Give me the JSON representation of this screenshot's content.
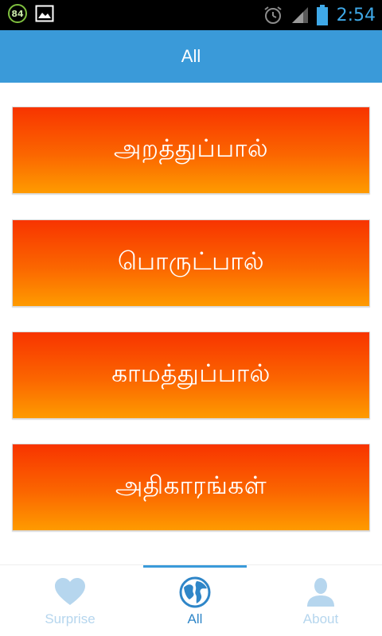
{
  "status_bar": {
    "notification_badge": "84",
    "clock": "2:54",
    "icons": [
      "notification-counter-icon",
      "gallery-icon",
      "alarm-icon",
      "signal-icon",
      "battery-icon"
    ]
  },
  "app_bar": {
    "title": "All"
  },
  "menu": {
    "items": [
      {
        "label": "அறத்துப்பால்"
      },
      {
        "label": "பொருட்பால்"
      },
      {
        "label": "காமத்துப்பால்"
      },
      {
        "label": "அதிகாரங்கள்"
      }
    ]
  },
  "bottom_nav": {
    "items": [
      {
        "label": "Surprise",
        "icon": "heart-icon",
        "active": false
      },
      {
        "label": "All",
        "icon": "globe-icon",
        "active": true
      },
      {
        "label": "About",
        "icon": "person-icon",
        "active": false
      }
    ]
  },
  "colors": {
    "app_bar": "#3a9ad9",
    "card_top": "#f83400",
    "card_bottom": "#fe9b00",
    "nav_active": "#2f86c8",
    "nav_inactive": "#b6d6ee",
    "clock": "#3fa9e8"
  }
}
